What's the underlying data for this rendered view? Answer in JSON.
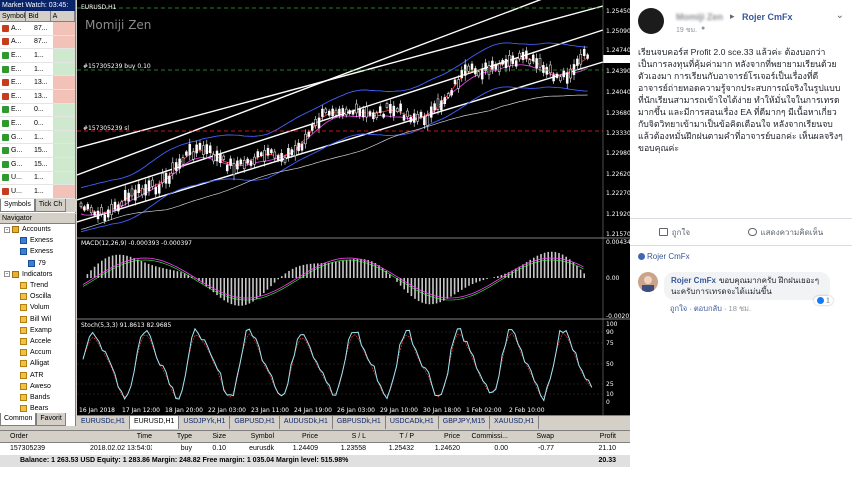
{
  "market_watch": {
    "title": "Market Watch: 03:45:",
    "headers": [
      "Symbol",
      "Bid",
      "A"
    ],
    "rows": [
      {
        "sym": "A...",
        "bid": "87...",
        "ico": "#c83c1e",
        "ask": "#f2c2b8"
      },
      {
        "sym": "A...",
        "bid": "87...",
        "ico": "#c83c1e",
        "ask": "#f2c2b8"
      },
      {
        "sym": "E...",
        "bid": "1...",
        "ico": "#2e9a2e",
        "ask": "#cfe9cf"
      },
      {
        "sym": "E...",
        "bid": "1...",
        "ico": "#2e9a2e",
        "ask": "#cfe9cf"
      },
      {
        "sym": "E...",
        "bid": "13...",
        "ico": "#c83c1e",
        "ask": "#f2c2b8"
      },
      {
        "sym": "E...",
        "bid": "13...",
        "ico": "#c83c1e",
        "ask": "#f2c2b8"
      },
      {
        "sym": "E...",
        "bid": "0...",
        "ico": "#2e9a2e",
        "ask": "#cfe9cf"
      },
      {
        "sym": "E...",
        "bid": "0...",
        "ico": "#2e9a2e",
        "ask": "#cfe9cf"
      },
      {
        "sym": "G...",
        "bid": "1...",
        "ico": "#2e9a2e",
        "ask": "#cfe9cf"
      },
      {
        "sym": "G...",
        "bid": "15...",
        "ico": "#2e9a2e",
        "ask": "#cfe9cf"
      },
      {
        "sym": "G...",
        "bid": "15...",
        "ico": "#2e9a2e",
        "ask": "#cfe9cf"
      },
      {
        "sym": "U...",
        "bid": "1...",
        "ico": "#2e9a2e",
        "ask": "#cfe9cf"
      },
      {
        "sym": "U...",
        "bid": "1...",
        "ico": "#c83c1e",
        "ask": "#f2c2b8"
      }
    ],
    "tabs": [
      "Symbols",
      "Tick Ch"
    ]
  },
  "navigator": {
    "title": "Navigator",
    "items": [
      {
        "label": "Accounts",
        "depth": 1,
        "kind": "folder"
      },
      {
        "label": "Exness",
        "depth": 2,
        "kind": "acc"
      },
      {
        "label": "Exness",
        "depth": 2,
        "kind": "acc"
      },
      {
        "label": "79",
        "depth": 3,
        "kind": "acc"
      },
      {
        "label": "Indicators",
        "depth": 1,
        "kind": "folder"
      },
      {
        "label": "Trend",
        "depth": 2,
        "kind": "ind"
      },
      {
        "label": "Oscilla",
        "depth": 2,
        "kind": "ind"
      },
      {
        "label": "Volum",
        "depth": 2,
        "kind": "ind"
      },
      {
        "label": "Bill Wil",
        "depth": 2,
        "kind": "ind"
      },
      {
        "label": "Examp",
        "depth": 2,
        "kind": "ind"
      },
      {
        "label": "Accele",
        "depth": 2,
        "kind": "ind"
      },
      {
        "label": "Accum",
        "depth": 2,
        "kind": "ind"
      },
      {
        "label": "Alligat",
        "depth": 2,
        "kind": "ind"
      },
      {
        "label": "ATR",
        "depth": 2,
        "kind": "ind"
      },
      {
        "label": "Aweso",
        "depth": 2,
        "kind": "ind"
      },
      {
        "label": "Bands",
        "depth": 2,
        "kind": "ind"
      },
      {
        "label": "Bears",
        "depth": 2,
        "kind": "ind"
      }
    ],
    "tabs": [
      "Common",
      "Favorit"
    ]
  },
  "chart": {
    "title": "EURUSD,H1",
    "watermark": "Momiji Zen",
    "order_label_1": "#157305239 buy 0.10",
    "order_label_2": "#157305239 sl",
    "order_top_label": "EURUSD,H1",
    "macd_label": "MACD(12,26,9) -0.000393 -0.000397",
    "stoch_label": "Stoch(5,3,3) 91.8613 82.9685",
    "price_ticks": [
      "1.25450",
      "1.25090",
      "1.24740",
      "1.24620",
      "1.24390",
      "1.24040",
      "1.23680",
      "1.23330",
      "1.22980",
      "1.22620",
      "1.22270",
      "1.21920",
      "1.21570"
    ],
    "macd_ticks": [
      "0.004346",
      "0.00",
      "-0.002016"
    ],
    "stoch_ticks": [
      "100",
      "90",
      "75",
      "50",
      "25",
      "10",
      "0"
    ],
    "time_ticks": [
      "16 Jan 2018",
      "17 Jan 12:00",
      "18 Jan 20:00",
      "22 Jan 03:00",
      "23 Jan 11:00",
      "24 Jan 19:00",
      "26 Jan 03:00",
      "29 Jan 10:00",
      "30 Jan 18:00",
      "1 Feb 02:00",
      "2 Feb 10:00"
    ],
    "colors": {
      "bg": "#000000",
      "channel": "#ffffff",
      "candle": "#ffffff",
      "ma_fast": "#ff3030",
      "ma_mid": "#e040e0",
      "ma_slow": "#4060ff",
      "ma_white": "#d0d0d0",
      "stoch_main": "#9fe7f5",
      "order_line": "#2ea82e",
      "sl_line": "#ff2020"
    }
  },
  "chart_tabs": [
    "EURUSDc,H1",
    "EURUSD,H1",
    "USDJPYk,H1",
    "GBPUSD,H1",
    "AUDUSDk,H1",
    "GBPUSDk,H1",
    "USDCADk,H1",
    "GBPJPY,M15",
    "XAUUSD,H1"
  ],
  "chart_tabs_active": 1,
  "terminal": {
    "headers": {
      "order": "Order",
      "time": "Time",
      "type": "Type",
      "size": "Size",
      "symbol": "Symbol",
      "price": "Price",
      "sl": "S / L",
      "tp": "T / P",
      "price2": "Price",
      "comm": "Commissi...",
      "swap": "Swap",
      "profit": "Profit"
    },
    "row": {
      "order": "157305239",
      "time": "2018.02.02 13:54:03",
      "type": "buy",
      "size": "0.10",
      "symbol": "eurusdk",
      "price": "1.24409",
      "sl": "1.23558",
      "tp": "1.25432",
      "price2": "1.24620",
      "comm": "0.00",
      "swap": "-0.77",
      "profit": "21.10"
    },
    "balance_text": "Balance: 1 263.53 USD  Equity: 1 283.86  Margin: 248.82  Free margin: 1 035.04  Margin level: 515.98%",
    "balance_profit": "20.33"
  },
  "post": {
    "author_blurred": "Momiji Zen",
    "page_name": "Rojer CmFx",
    "time": "19 ชม.",
    "body": "เรียนจบคอร์ส Profit 2.0 sce.33 แล้วค่ะ ต้องบอกว่าเป็นการลงทุนที่คุ้มค่ามาก หลังจากที่พยายามเรียนด้วยตัวเองมา การเรียนกับอาจารย์โรเจอร์เป็นเรื่องที่ดี อาจารย์ถ่ายทอดความรู้จากประสบการณ์จริงในรูปแบบที่นักเรียนสามารถเข้าใจได้ง่าย ทำให้มั่นใจในการเทรดมากขึ้น และมีการสอนเรื่อง EA ที่ดีมากๆ มีเนื้อหาเกี่ยวกับจิตวิทยาเข้ามาเป็นข้อคิดเตือนใจ หลังจากเรียนจบแล้วต้องหมั่นฝึกฝนตามคำที่อาจารย์บอกค่ะ เห็นผลจริงๆ ขอบคุณค่ะ",
    "like_label": "ถูกใจ",
    "comment_label": "แสดงความคิดเห็น",
    "page_ref": "Rojer CmFx",
    "reply": {
      "name": "Rojer CmFx",
      "text": "ขอบคุณมากครับ ฝึกฝนเยอะๆนะครับการเทรดจะได้แม่นขึ้น",
      "like": "ถูกใจ",
      "reply": "ตอบกลับ",
      "time": "18 ชม.",
      "reaction_count": "1"
    }
  }
}
